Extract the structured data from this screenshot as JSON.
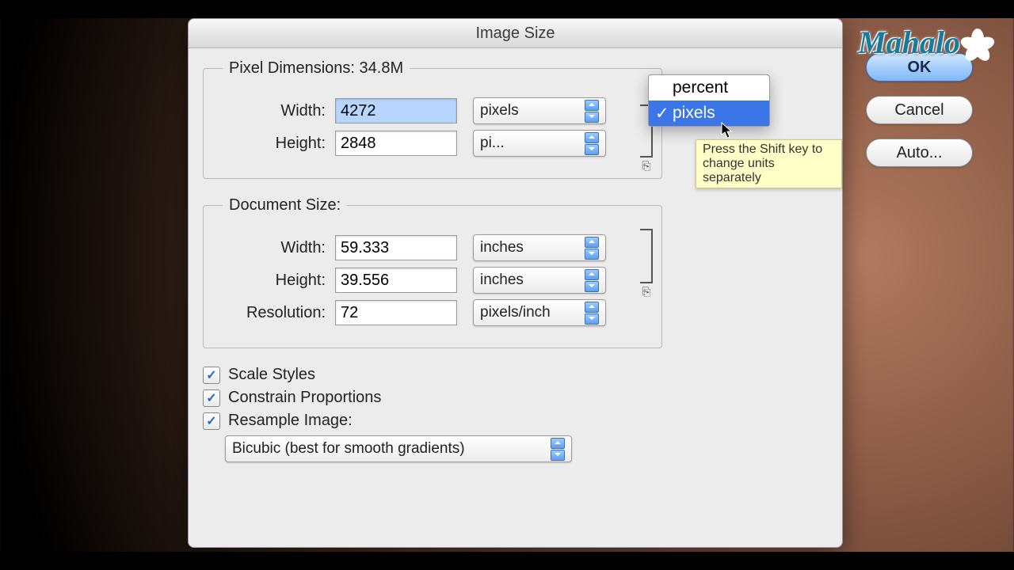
{
  "watermark": "Mahalo",
  "dialog_title": "Image Size",
  "pixel_dimensions": {
    "legend_prefix": "Pixel Dimensions:",
    "size": "34.8M",
    "width_label": "Width:",
    "width_value": "4272",
    "height_label": "Height:",
    "height_value": "2848",
    "unit_dropdown": {
      "options": [
        "percent",
        "pixels"
      ],
      "selected": "pixels"
    }
  },
  "document_size": {
    "legend": "Document Size:",
    "width_label": "Width:",
    "width_value": "59.333",
    "width_unit": "inches",
    "height_label": "Height:",
    "height_value": "39.556",
    "height_unit": "inches",
    "resolution_label": "Resolution:",
    "resolution_value": "72",
    "resolution_unit": "pixels/inch"
  },
  "checkboxes": {
    "scale_styles": "Scale Styles",
    "constrain": "Constrain Proportions",
    "resample": "Resample Image:"
  },
  "resample_method": "Bicubic (best for smooth gradients)",
  "buttons": {
    "ok": "OK",
    "cancel": "Cancel",
    "auto": "Auto..."
  },
  "tooltip": "Press the Shift key to change units separately"
}
